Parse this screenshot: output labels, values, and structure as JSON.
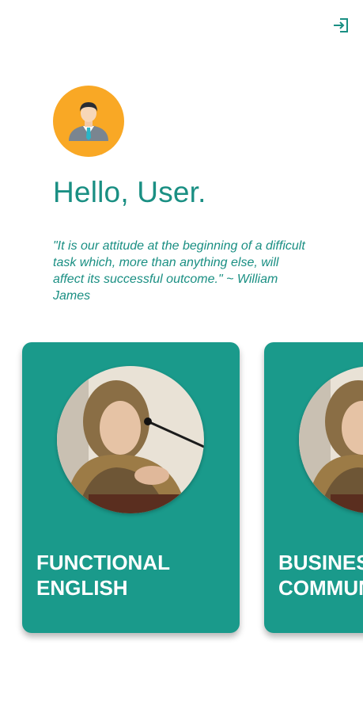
{
  "header": {
    "logout_icon": "logout-icon"
  },
  "profile": {
    "avatar_icon": "user-avatar-icon",
    "greeting": "Hello, User.",
    "quote": "\"It is our attitude at the beginning of a difficult task which, more than anything else, will affect its successful outcome.\" ~ William James"
  },
  "courses": [
    {
      "title": "FUNCTIONAL\nENGLISH"
    },
    {
      "title": "BUSINESS\nCOMMUNICATION"
    }
  ],
  "colors": {
    "accent": "#1a8f83",
    "card": "#1a9a8b",
    "avatar_bg": "#f9a825"
  }
}
